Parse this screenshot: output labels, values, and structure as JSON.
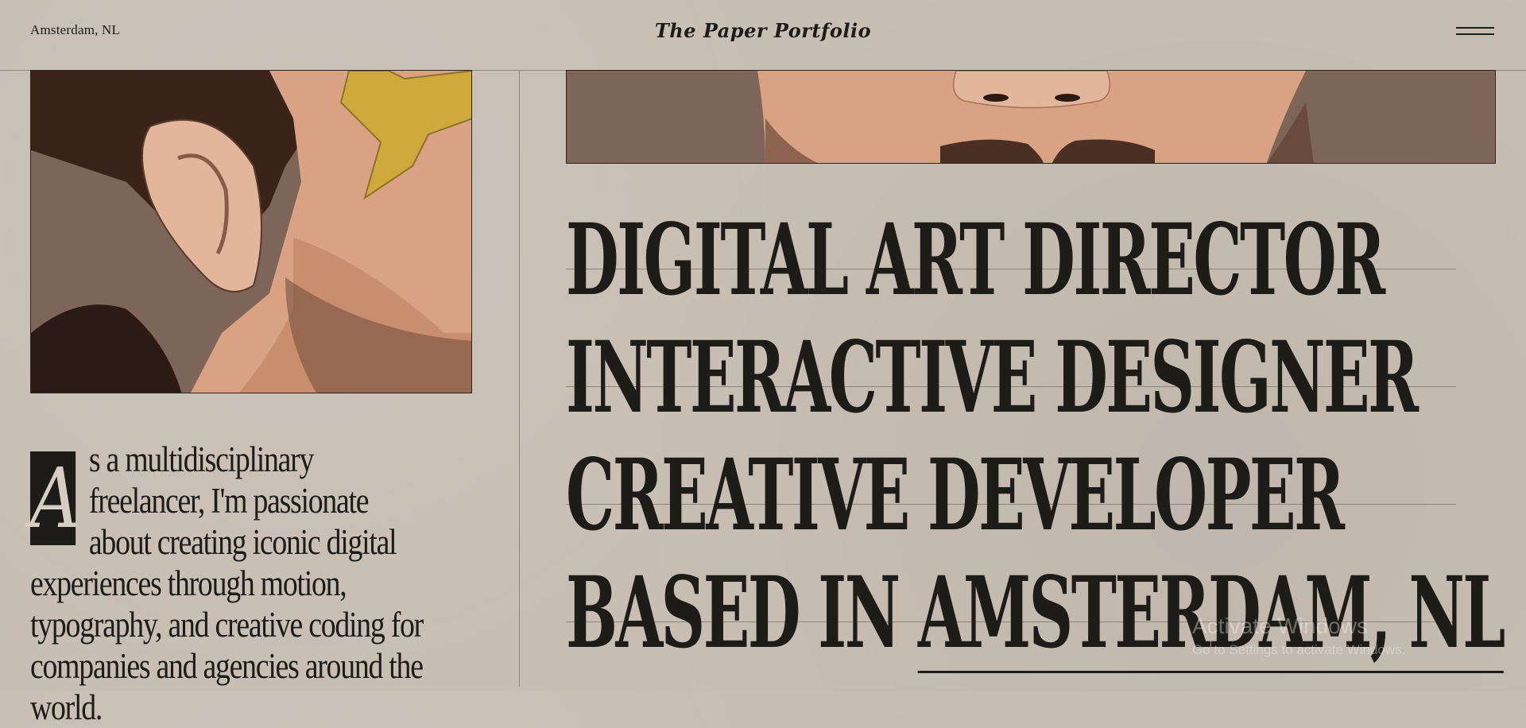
{
  "header": {
    "location": "Amsterdam, NL",
    "brand": "The Paper Portfolio",
    "menu_icon": "hamburger-menu-icon"
  },
  "intro": {
    "dropcap": "A",
    "text": "s a multidisciplinary freelancer, I'm passionate about creating iconic digital experiences through motion, typography, and creative coding for companies and agencies around the world."
  },
  "headline": {
    "line1": "DIGITAL ART DIRECTOR",
    "line2": "INTERACTIVE DESIGNER",
    "line3": "CREATIVE DEVELOPER",
    "line4_prefix": "BASED IN ",
    "line4_link": "AMSTERDAM, NL"
  },
  "watermark": {
    "title": "Activate Windows",
    "subtitle": "Go to Settings to activate Windows."
  },
  "colors": {
    "paper": "#c8beb4",
    "ink": "#1d1c18",
    "rule": "#8d857c",
    "skin": "#d9a283",
    "star": "#cfa93b"
  }
}
